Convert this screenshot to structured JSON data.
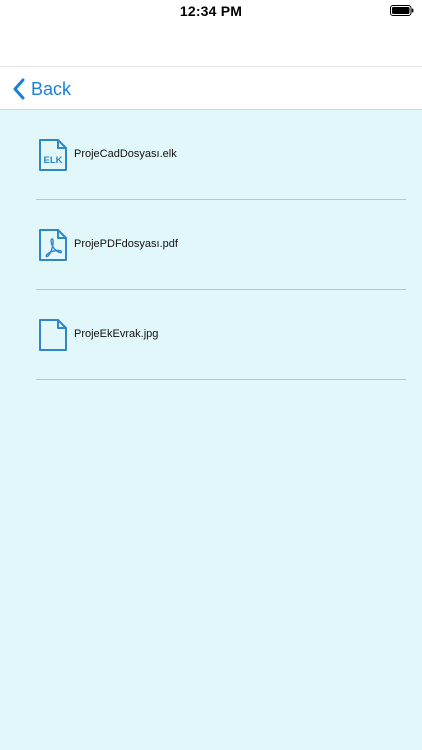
{
  "status_bar": {
    "time": "12:34 PM"
  },
  "nav": {
    "back_label": "Back"
  },
  "files": [
    {
      "name": "ProjeCadDosyası.elk",
      "icon": "elk-file-icon",
      "badge": "ELK"
    },
    {
      "name": "ProjePDFdosyası.pdf",
      "icon": "pdf-file-icon"
    },
    {
      "name": "ProjeEkEvrak.jpg",
      "icon": "document-file-icon"
    }
  ],
  "colors": {
    "accent": "#1a7fd9",
    "icon": "#2f86c9",
    "content_background": "#e1f7f9",
    "divider": "#b9c4c6"
  }
}
